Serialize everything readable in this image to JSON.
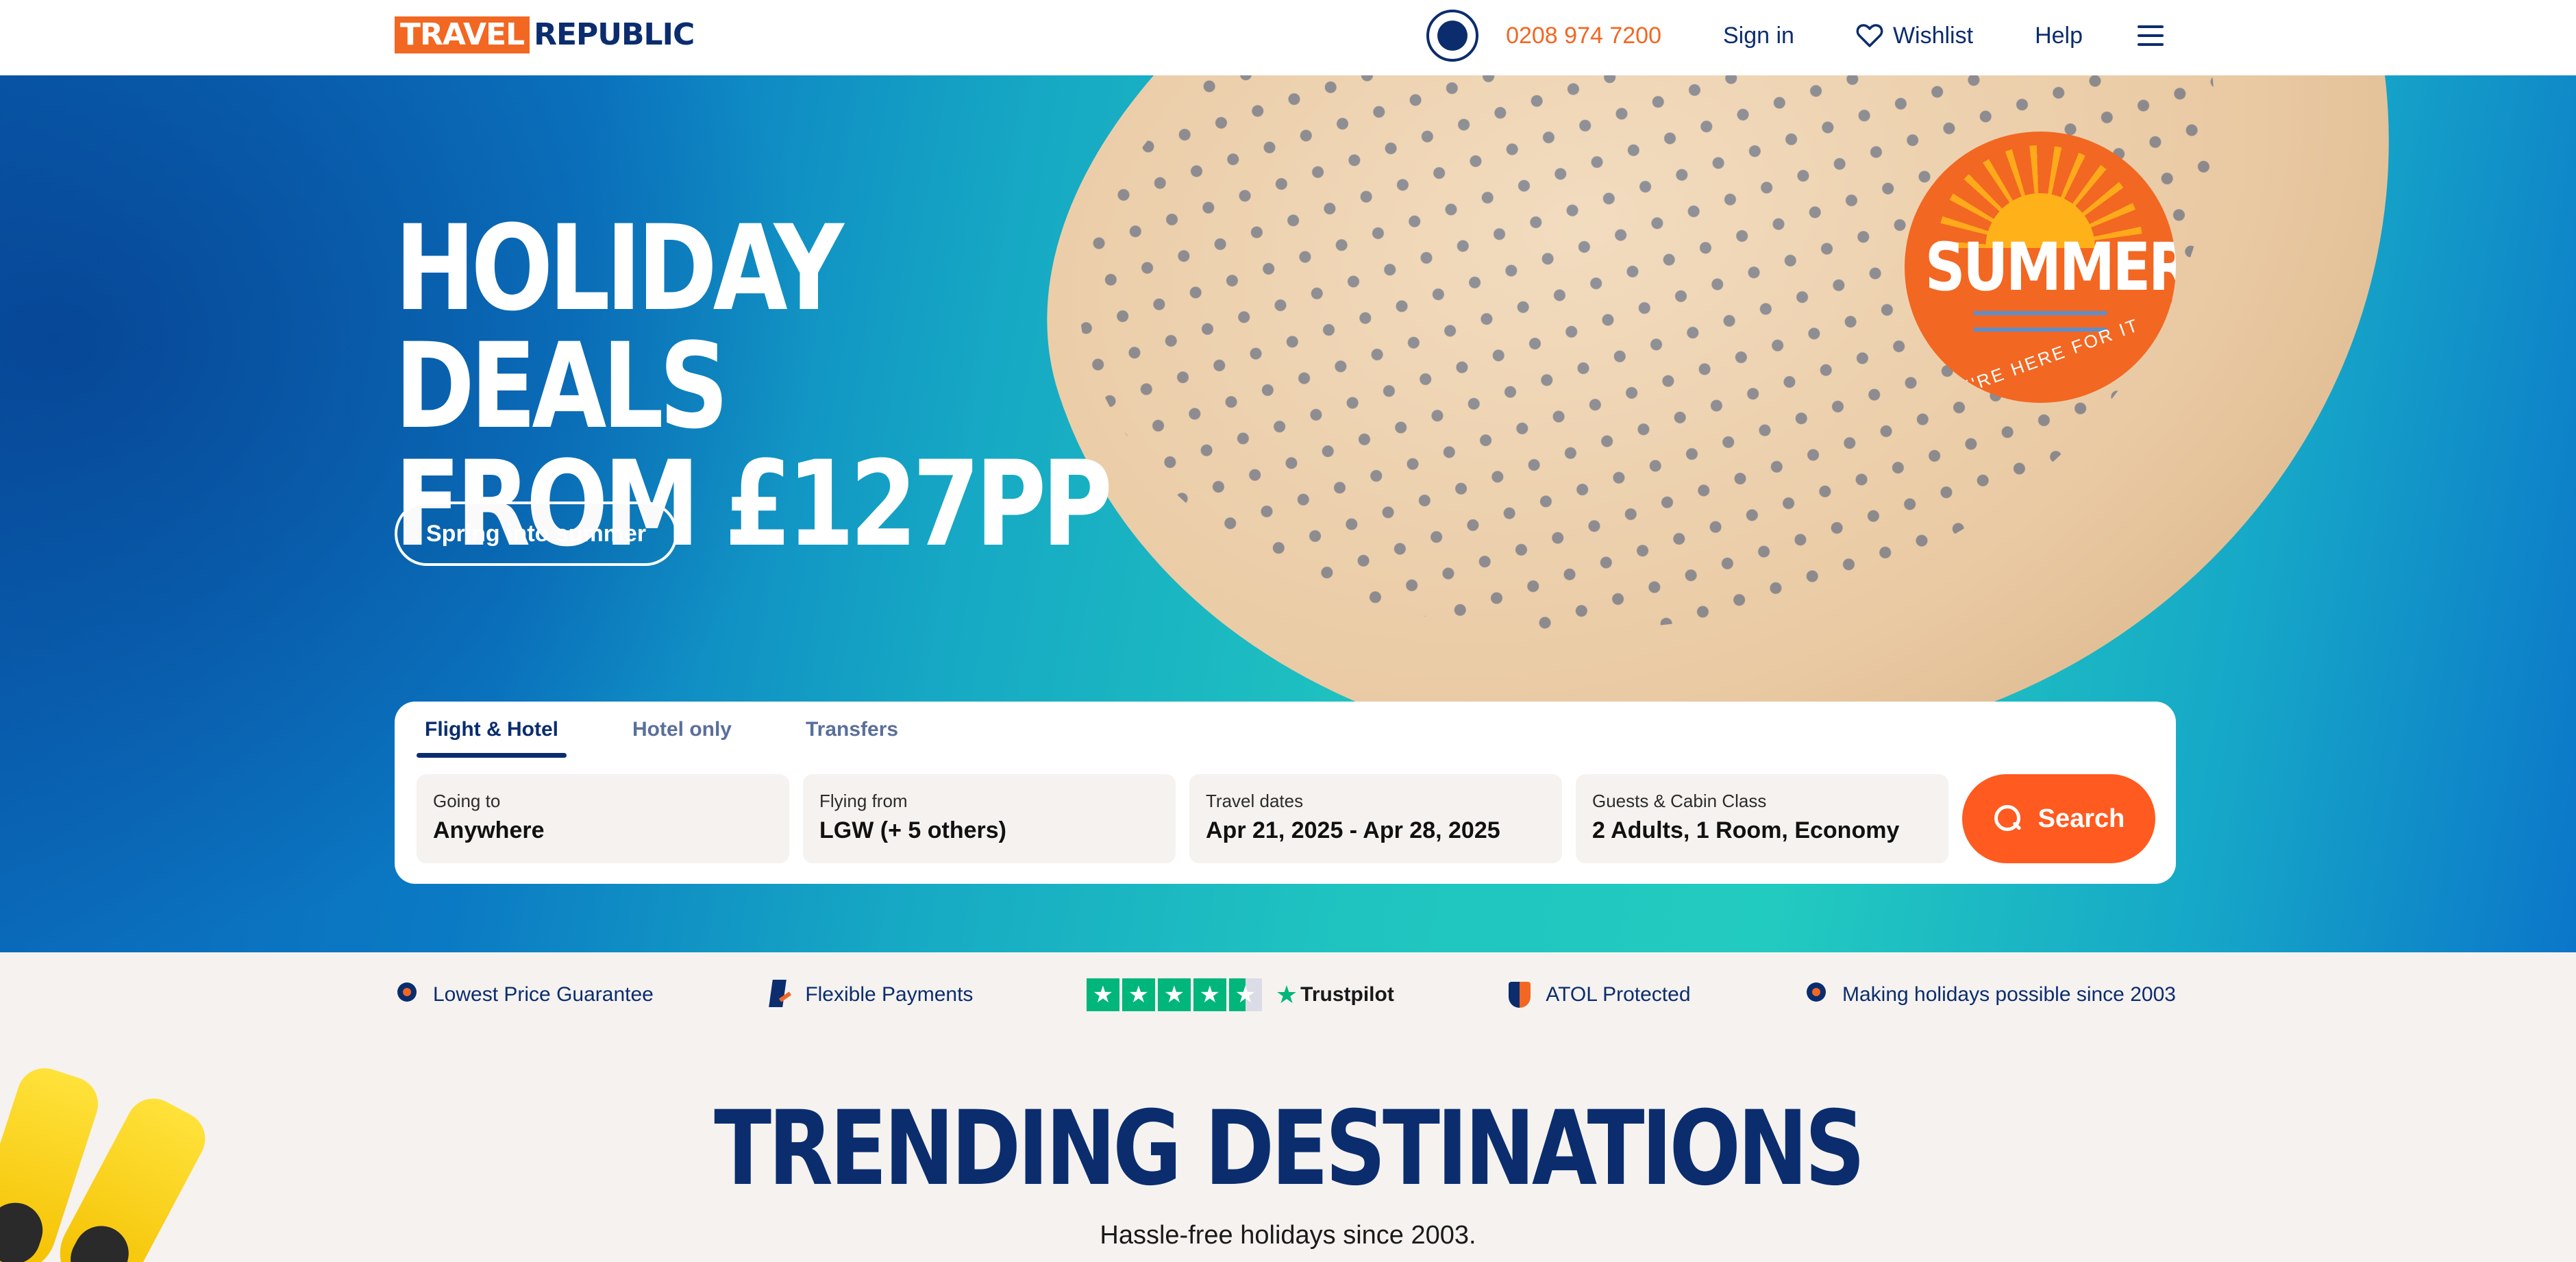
{
  "header": {
    "logo_part1": "TRAVEL",
    "logo_part2": "REPUBLIC",
    "phone": "0208 974 7200",
    "sign_in": "Sign in",
    "wishlist": "Wishlist",
    "help": "Help"
  },
  "hero": {
    "title_line1": "HOLIDAY DEALS",
    "title_line2": "FROM £127PP",
    "cta": "Spring into summer",
    "badge_title": "SUMMER",
    "badge_tagline": "WE'RE HERE FOR IT"
  },
  "search": {
    "tabs": [
      {
        "label": "Flight & Hotel",
        "active": true
      },
      {
        "label": "Hotel only",
        "active": false
      },
      {
        "label": "Transfers",
        "active": false
      }
    ],
    "fields": [
      {
        "label": "Going to",
        "value": "Anywhere"
      },
      {
        "label": "Flying from",
        "value": "LGW (+ 5 others)"
      },
      {
        "label": "Travel dates",
        "value": "Apr 21, 2025 - Apr 28, 2025"
      },
      {
        "label": "Guests & Cabin Class",
        "value": "2 Adults, 1 Room, Economy"
      }
    ],
    "button": "Search"
  },
  "trust": {
    "items": [
      {
        "label": "Lowest Price Guarantee",
        "icon": "medal-icon"
      },
      {
        "label": "Flexible Payments",
        "icon": "card-icon"
      },
      {
        "label": "ATOL Protected",
        "icon": "shield-icon"
      },
      {
        "label": "Making holidays possible since 2003",
        "icon": "medal-icon"
      }
    ],
    "trustpilot_label": "Trustpilot",
    "trustpilot_stars": 4.5
  },
  "trending": {
    "title": "TRENDING DESTINATIONS",
    "subtitle": "Hassle-free holidays since 2003."
  },
  "colors": {
    "brand_orange": "#f26722",
    "brand_navy": "#0b2d6e",
    "search_button": "#ff5a1f",
    "trustpilot_green": "#00b67a"
  }
}
